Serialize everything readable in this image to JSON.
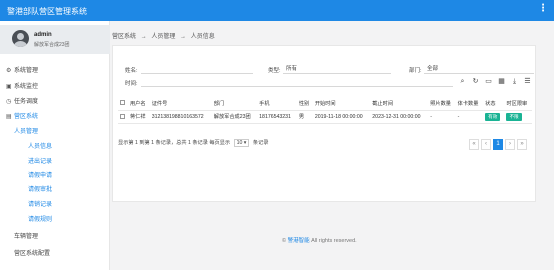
{
  "app": {
    "title": "警港部队营区管理系统",
    "more_icon": "more-vertical-icon"
  },
  "user": {
    "name": "admin",
    "role": "解放军合成23团"
  },
  "sidebar": {
    "items": [
      {
        "label": "系统管理",
        "icon": "gear-icon"
      },
      {
        "label": "系统监控",
        "icon": "monitor-icon"
      },
      {
        "label": "任务调度",
        "icon": "clock-icon"
      },
      {
        "label": "营区系统",
        "icon": "building-icon"
      },
      {
        "label": "人员管理"
      },
      {
        "label": "人员信息"
      },
      {
        "label": "进出记录"
      },
      {
        "label": "请假申请"
      },
      {
        "label": "请假审批"
      },
      {
        "label": "请销记录"
      },
      {
        "label": "请假规则"
      },
      {
        "label": "车辆管理"
      },
      {
        "label": "营区系统配置"
      }
    ]
  },
  "breadcrumb": {
    "items": [
      "营区系统",
      "→",
      "人员管理",
      "→",
      "人员信息"
    ]
  },
  "filters": {
    "name_label": "姓名:",
    "type_label": "类型:",
    "type_value": "所有",
    "dept_label": "部门:",
    "dept_value": "全部",
    "time_label": "时间:"
  },
  "toolbar_icons": [
    "search-icon",
    "refresh-icon",
    "card-icon",
    "grid-icon",
    "download-icon",
    "list-icon"
  ],
  "table": {
    "headers": [
      "用户名",
      "证件号",
      "部门",
      "手机",
      "性别",
      "开始时间",
      "截止时间",
      "照片数量",
      "体卡数量",
      "状态",
      "时区限审"
    ],
    "rows": [
      {
        "cells": [
          "蒋仁祥",
          "312138198810163572",
          "解放军合成23团",
          "18176543231",
          "男",
          "2019-11-18 00:00:00",
          "2023-12-31 00:00:00",
          "-",
          "-"
        ],
        "status": "有效",
        "zone": "不限"
      }
    ]
  },
  "pagination": {
    "info_prefix": "显示第 1 到第 1 条记录，总共 1 条记录 每页显示",
    "page_size": "10 ▾",
    "info_suffix": "条记录",
    "buttons": [
      "«",
      "‹",
      "1",
      "›",
      "»"
    ]
  },
  "footer": {
    "prefix": "©",
    "brand": "警港智能",
    "rest": "All rights reserved."
  },
  "colors": {
    "primary": "#1e88e5",
    "success": "#1ab394"
  }
}
